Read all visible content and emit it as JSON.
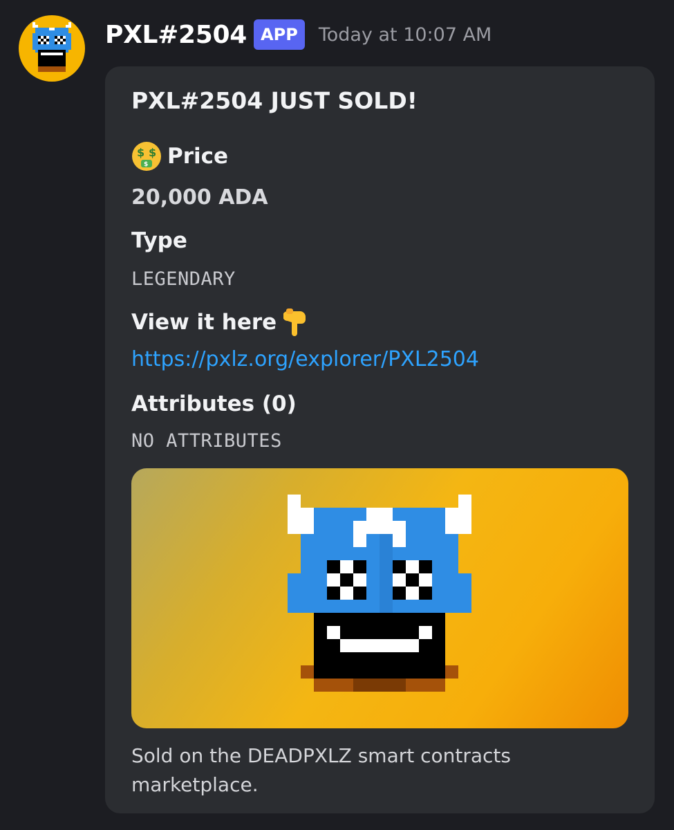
{
  "message": {
    "author": "PXL#2504",
    "badge": "APP",
    "timestamp": "Today at 10:07 AM",
    "avatar_icon": "pixel-monster-avatar"
  },
  "embed": {
    "title": "PXL#2504 JUST SOLD!",
    "fields": {
      "price": {
        "icon": "money-mouth-face-emoji",
        "name": "Price",
        "value": "20,000 ADA"
      },
      "type": {
        "name": "Type",
        "value": "LEGENDARY"
      },
      "view": {
        "name": "View it here",
        "icon": "pointing-down-emoji",
        "value": "https://pxlz.org/explorer/PXL2504"
      },
      "attributes": {
        "name": "Attributes (0)",
        "value": "NO ATTRIBUTES"
      }
    },
    "image": {
      "subject": "pixel-monster-nft",
      "background": [
        "#b6a85c",
        "#f4b613",
        "#ef8d02"
      ]
    },
    "footer": "Sold on the DEADPXLZ smart contracts marketplace."
  },
  "colors": {
    "background": "#1c1d22",
    "embed_bg": "#2b2d31",
    "badge": "#5865f2",
    "link": "#2ea3ff"
  }
}
